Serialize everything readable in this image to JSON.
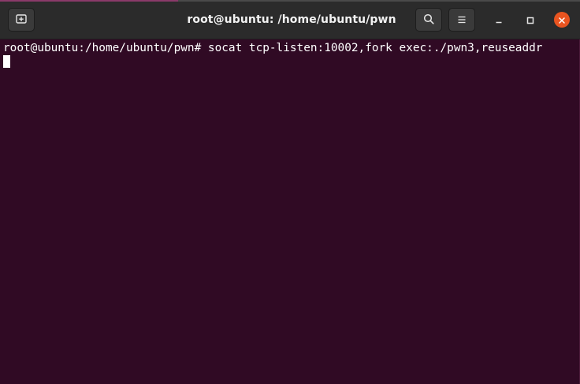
{
  "window": {
    "title": "root@ubuntu: /home/ubuntu/pwn"
  },
  "headerbar": {
    "icons": {
      "new_tab": "new-tab-icon",
      "search": "search-icon",
      "menu": "hamburger-menu-icon",
      "minimize": "minimize-icon",
      "maximize": "maximize-icon",
      "close": "close-icon"
    },
    "colors": {
      "close_button": "#e95420",
      "background": "#2b2b2b"
    }
  },
  "terminal": {
    "background": "#300a24",
    "lines": [
      {
        "prompt": "root@ubuntu:/home/ubuntu/pwn# ",
        "command": "socat tcp-listen:10002,fork exec:./pwn3,reuseaddr"
      }
    ]
  }
}
